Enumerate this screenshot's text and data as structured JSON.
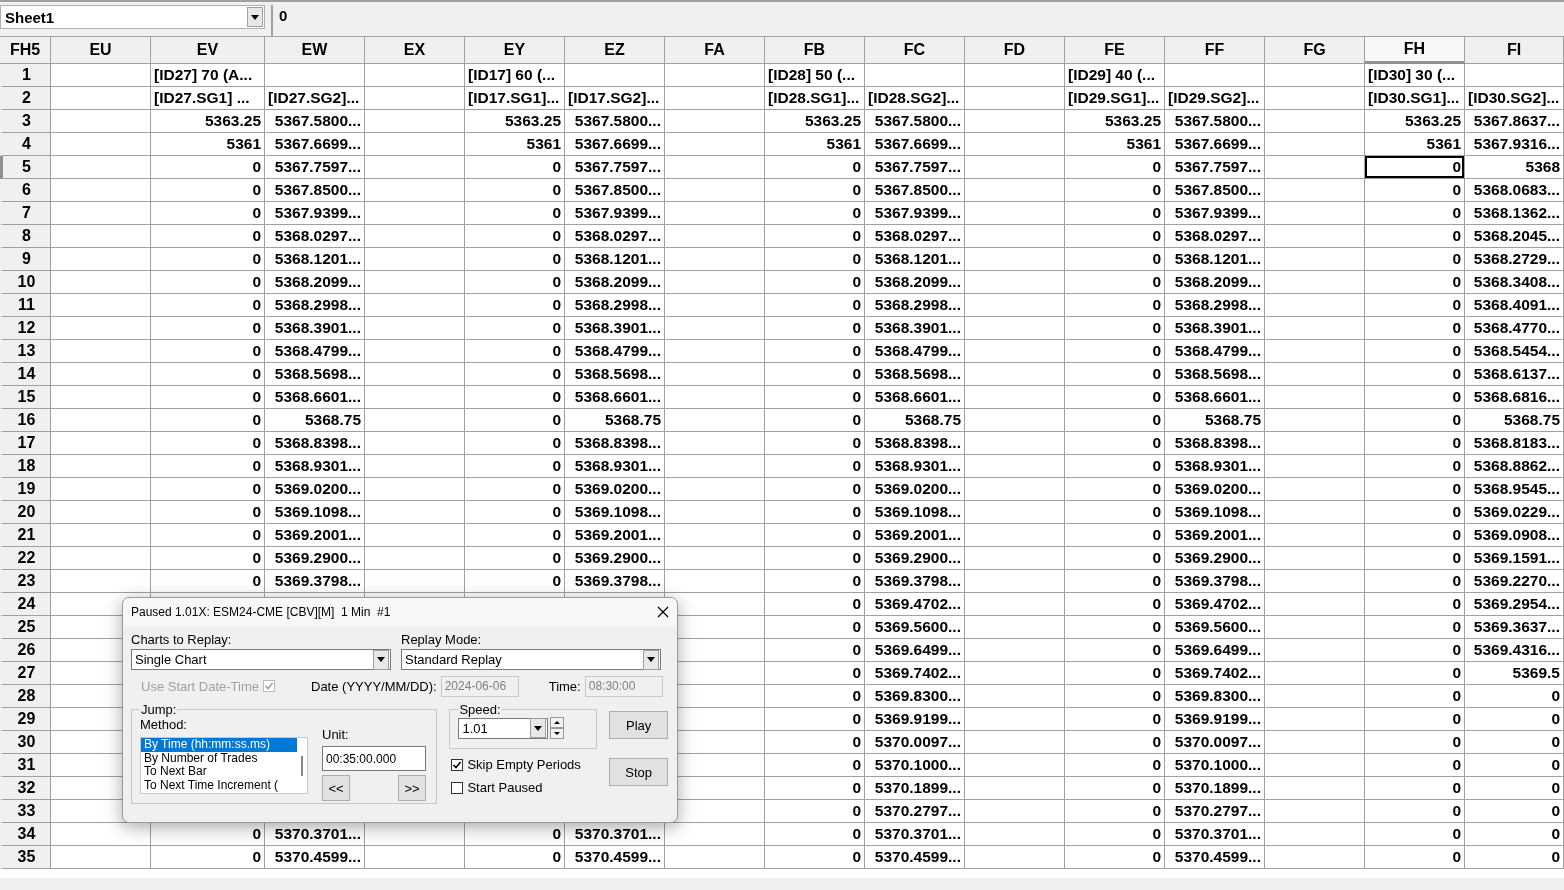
{
  "name_box": {
    "value": "Sheet1"
  },
  "formula_bar": {
    "value": "0"
  },
  "sheet": {
    "corner": "FH5",
    "columns": [
      {
        "label": "EU",
        "selected": false
      },
      {
        "label": "EV",
        "selected": false
      },
      {
        "label": "EW",
        "selected": false
      },
      {
        "label": "EX",
        "selected": false
      },
      {
        "label": "EY",
        "selected": false
      },
      {
        "label": "EZ",
        "selected": false
      },
      {
        "label": "FA",
        "selected": false
      },
      {
        "label": "FB",
        "selected": false
      },
      {
        "label": "FC",
        "selected": false
      },
      {
        "label": "FD",
        "selected": false
      },
      {
        "label": "FE",
        "selected": false
      },
      {
        "label": "FF",
        "selected": false
      },
      {
        "label": "FG",
        "selected": false
      },
      {
        "label": "FH",
        "selected": true
      },
      {
        "label": "FI",
        "selected": false
      }
    ],
    "rows": [
      {
        "label": "1",
        "selected": false,
        "kind": "text",
        "cells": [
          null,
          "[ID27] 70 (A...",
          null,
          null,
          "[ID17] 60 (...",
          null,
          null,
          "[ID28] 50 (...",
          null,
          null,
          "[ID29] 40 (...",
          null,
          null,
          "[ID30] 30 (...",
          null
        ]
      },
      {
        "label": "2",
        "selected": false,
        "kind": "text",
        "cells": [
          null,
          "[ID27.SG1] ...",
          "[ID27.SG2]...",
          null,
          "[ID17.SG1]...",
          "[ID17.SG2]...",
          null,
          "[ID28.SG1]...",
          "[ID28.SG2]...",
          null,
          "[ID29.SG1]...",
          "[ID29.SG2]...",
          null,
          "[ID30.SG1]...",
          "[ID30.SG2]..."
        ]
      },
      {
        "label": "3",
        "selected": false,
        "kind": "number",
        "cells": [
          null,
          "5363.25",
          "5367.5800...",
          null,
          "5363.25",
          "5367.5800...",
          null,
          "5363.25",
          "5367.5800...",
          null,
          "5363.25",
          "5367.5800...",
          null,
          "5363.25",
          "5367.8637..."
        ]
      },
      {
        "label": "4",
        "selected": false,
        "kind": "number",
        "cells": [
          null,
          "5361",
          "5367.6699...",
          null,
          "5361",
          "5367.6699...",
          null,
          "5361",
          "5367.6699...",
          null,
          "5361",
          "5367.6699...",
          null,
          "5361",
          "5367.9316..."
        ]
      },
      {
        "label": "5",
        "selected": true,
        "kind": "number",
        "cells": [
          null,
          "0",
          "5367.7597...",
          null,
          "0",
          "5367.7597...",
          null,
          "0",
          "5367.7597...",
          null,
          "0",
          "5367.7597...",
          null,
          "0",
          "5368"
        ]
      },
      {
        "label": "6",
        "selected": false,
        "kind": "number",
        "cells": [
          null,
          "0",
          "5367.8500...",
          null,
          "0",
          "5367.8500...",
          null,
          "0",
          "5367.8500...",
          null,
          "0",
          "5367.8500...",
          null,
          "0",
          "5368.0683..."
        ]
      },
      {
        "label": "7",
        "selected": false,
        "kind": "number",
        "cells": [
          null,
          "0",
          "5367.9399...",
          null,
          "0",
          "5367.9399...",
          null,
          "0",
          "5367.9399...",
          null,
          "0",
          "5367.9399...",
          null,
          "0",
          "5368.1362..."
        ]
      },
      {
        "label": "8",
        "selected": false,
        "kind": "number",
        "cells": [
          null,
          "0",
          "5368.0297...",
          null,
          "0",
          "5368.0297...",
          null,
          "0",
          "5368.0297...",
          null,
          "0",
          "5368.0297...",
          null,
          "0",
          "5368.2045..."
        ]
      },
      {
        "label": "9",
        "selected": false,
        "kind": "number",
        "cells": [
          null,
          "0",
          "5368.1201...",
          null,
          "0",
          "5368.1201...",
          null,
          "0",
          "5368.1201...",
          null,
          "0",
          "5368.1201...",
          null,
          "0",
          "5368.2729..."
        ]
      },
      {
        "label": "10",
        "selected": false,
        "kind": "number",
        "cells": [
          null,
          "0",
          "5368.2099...",
          null,
          "0",
          "5368.2099...",
          null,
          "0",
          "5368.2099...",
          null,
          "0",
          "5368.2099...",
          null,
          "0",
          "5368.3408..."
        ]
      },
      {
        "label": "11",
        "selected": false,
        "kind": "number",
        "cells": [
          null,
          "0",
          "5368.2998...",
          null,
          "0",
          "5368.2998...",
          null,
          "0",
          "5368.2998...",
          null,
          "0",
          "5368.2998...",
          null,
          "0",
          "5368.4091..."
        ]
      },
      {
        "label": "12",
        "selected": false,
        "kind": "number",
        "cells": [
          null,
          "0",
          "5368.3901...",
          null,
          "0",
          "5368.3901...",
          null,
          "0",
          "5368.3901...",
          null,
          "0",
          "5368.3901...",
          null,
          "0",
          "5368.4770..."
        ]
      },
      {
        "label": "13",
        "selected": false,
        "kind": "number",
        "cells": [
          null,
          "0",
          "5368.4799...",
          null,
          "0",
          "5368.4799...",
          null,
          "0",
          "5368.4799...",
          null,
          "0",
          "5368.4799...",
          null,
          "0",
          "5368.5454..."
        ]
      },
      {
        "label": "14",
        "selected": false,
        "kind": "number",
        "cells": [
          null,
          "0",
          "5368.5698...",
          null,
          "0",
          "5368.5698...",
          null,
          "0",
          "5368.5698...",
          null,
          "0",
          "5368.5698...",
          null,
          "0",
          "5368.6137..."
        ]
      },
      {
        "label": "15",
        "selected": false,
        "kind": "number",
        "cells": [
          null,
          "0",
          "5368.6601...",
          null,
          "0",
          "5368.6601...",
          null,
          "0",
          "5368.6601...",
          null,
          "0",
          "5368.6601...",
          null,
          "0",
          "5368.6816..."
        ]
      },
      {
        "label": "16",
        "selected": false,
        "kind": "number",
        "cells": [
          null,
          "0",
          "5368.75",
          null,
          "0",
          "5368.75",
          null,
          "0",
          "5368.75",
          null,
          "0",
          "5368.75",
          null,
          "0",
          "5368.75"
        ]
      },
      {
        "label": "17",
        "selected": false,
        "kind": "number",
        "cells": [
          null,
          "0",
          "5368.8398...",
          null,
          "0",
          "5368.8398...",
          null,
          "0",
          "5368.8398...",
          null,
          "0",
          "5368.8398...",
          null,
          "0",
          "5368.8183..."
        ]
      },
      {
        "label": "18",
        "selected": false,
        "kind": "number",
        "cells": [
          null,
          "0",
          "5368.9301...",
          null,
          "0",
          "5368.9301...",
          null,
          "0",
          "5368.9301...",
          null,
          "0",
          "5368.9301...",
          null,
          "0",
          "5368.8862..."
        ]
      },
      {
        "label": "19",
        "selected": false,
        "kind": "number",
        "cells": [
          null,
          "0",
          "5369.0200...",
          null,
          "0",
          "5369.0200...",
          null,
          "0",
          "5369.0200...",
          null,
          "0",
          "5369.0200...",
          null,
          "0",
          "5368.9545..."
        ]
      },
      {
        "label": "20",
        "selected": false,
        "kind": "number",
        "cells": [
          null,
          "0",
          "5369.1098...",
          null,
          "0",
          "5369.1098...",
          null,
          "0",
          "5369.1098...",
          null,
          "0",
          "5369.1098...",
          null,
          "0",
          "5369.0229..."
        ]
      },
      {
        "label": "21",
        "selected": false,
        "kind": "number",
        "cells": [
          null,
          "0",
          "5369.2001...",
          null,
          "0",
          "5369.2001...",
          null,
          "0",
          "5369.2001...",
          null,
          "0",
          "5369.2001...",
          null,
          "0",
          "5369.0908..."
        ]
      },
      {
        "label": "22",
        "selected": false,
        "kind": "number",
        "cells": [
          null,
          "0",
          "5369.2900...",
          null,
          "0",
          "5369.2900...",
          null,
          "0",
          "5369.2900...",
          null,
          "0",
          "5369.2900...",
          null,
          "0",
          "5369.1591..."
        ]
      },
      {
        "label": "23",
        "selected": false,
        "kind": "number",
        "cells": [
          null,
          "0",
          "5369.3798...",
          null,
          "0",
          "5369.3798...",
          null,
          "0",
          "5369.3798...",
          null,
          "0",
          "5369.3798...",
          null,
          "0",
          "5369.2270..."
        ]
      },
      {
        "label": "24",
        "selected": false,
        "kind": "number",
        "cells": [
          null,
          null,
          null,
          null,
          null,
          null,
          null,
          "0",
          "5369.4702...",
          null,
          "0",
          "5369.4702...",
          null,
          "0",
          "5369.2954..."
        ]
      },
      {
        "label": "25",
        "selected": false,
        "kind": "number",
        "cells": [
          null,
          null,
          null,
          null,
          null,
          null,
          null,
          "0",
          "5369.5600...",
          null,
          "0",
          "5369.5600...",
          null,
          "0",
          "5369.3637..."
        ]
      },
      {
        "label": "26",
        "selected": false,
        "kind": "number",
        "cells": [
          null,
          null,
          null,
          null,
          null,
          null,
          null,
          "0",
          "5369.6499...",
          null,
          "0",
          "5369.6499...",
          null,
          "0",
          "5369.4316..."
        ]
      },
      {
        "label": "27",
        "selected": false,
        "kind": "number",
        "cells": [
          null,
          null,
          null,
          null,
          null,
          null,
          null,
          "0",
          "5369.7402...",
          null,
          "0",
          "5369.7402...",
          null,
          "0",
          "5369.5"
        ]
      },
      {
        "label": "28",
        "selected": false,
        "kind": "number",
        "cells": [
          null,
          null,
          null,
          null,
          null,
          null,
          null,
          "0",
          "5369.8300...",
          null,
          "0",
          "5369.8300...",
          null,
          "0",
          "0"
        ]
      },
      {
        "label": "29",
        "selected": false,
        "kind": "number",
        "cells": [
          null,
          null,
          null,
          null,
          null,
          null,
          null,
          "0",
          "5369.9199...",
          null,
          "0",
          "5369.9199...",
          null,
          "0",
          "0"
        ]
      },
      {
        "label": "30",
        "selected": false,
        "kind": "number",
        "cells": [
          null,
          null,
          null,
          null,
          null,
          null,
          null,
          "0",
          "5370.0097...",
          null,
          "0",
          "5370.0097...",
          null,
          "0",
          "0"
        ]
      },
      {
        "label": "31",
        "selected": false,
        "kind": "number",
        "cells": [
          null,
          null,
          null,
          null,
          null,
          null,
          null,
          "0",
          "5370.1000...",
          null,
          "0",
          "5370.1000...",
          null,
          "0",
          "0"
        ]
      },
      {
        "label": "32",
        "selected": false,
        "kind": "number",
        "cells": [
          null,
          null,
          null,
          null,
          null,
          null,
          null,
          "0",
          "5370.1899...",
          null,
          "0",
          "5370.1899...",
          null,
          "0",
          "0"
        ]
      },
      {
        "label": "33",
        "selected": false,
        "kind": "number",
        "cells": [
          null,
          null,
          null,
          null,
          null,
          null,
          null,
          "0",
          "5370.2797...",
          null,
          "0",
          "5370.2797...",
          null,
          "0",
          "0"
        ]
      },
      {
        "label": "34",
        "selected": false,
        "kind": "number",
        "cells": [
          null,
          "0",
          "5370.3701...",
          null,
          "0",
          "5370.3701...",
          null,
          "0",
          "5370.3701...",
          null,
          "0",
          "5370.3701...",
          null,
          "0",
          "0"
        ]
      },
      {
        "label": "35",
        "selected": false,
        "kind": "number",
        "cells": [
          null,
          "0",
          "5370.4599...",
          null,
          "0",
          "5370.4599...",
          null,
          "0",
          "5370.4599...",
          null,
          "0",
          "5370.4599...",
          null,
          "0",
          "0"
        ]
      }
    ]
  },
  "replay_dialog": {
    "title": "Paused 1.01X: ESM24-CME [CBV][M]  1 Min  #1",
    "charts_to_replay": {
      "label": "Charts to Replay:",
      "value": "Single Chart"
    },
    "replay_mode": {
      "label": "Replay Mode:",
      "value": "Standard Replay"
    },
    "use_start_date_time": {
      "label": "Use Start Date-Time",
      "checked": true,
      "disabled": true
    },
    "date": {
      "label": "Date (YYYY/MM/DD):",
      "value": "2024-06-06",
      "disabled": true
    },
    "time": {
      "label": "Time:",
      "value": "08:30:00",
      "disabled": true
    },
    "jump": {
      "title": "Jump:",
      "method_label": "Method:",
      "methods": [
        {
          "label": "By Time (hh:mm:ss.ms)",
          "selected": true
        },
        {
          "label": "By Number of Trades",
          "selected": false
        },
        {
          "label": "To Next Bar",
          "selected": false
        },
        {
          "label": "To Next Time Increment (",
          "selected": false
        }
      ],
      "unit_label": "Unit:",
      "unit_value": "00:35:00.000",
      "back_button": "<<",
      "forward_button": ">>"
    },
    "speed": {
      "title": "Speed:",
      "value": "1.01"
    },
    "options": [
      {
        "label": "Skip Empty Periods",
        "checked": true
      },
      {
        "label": "Start Paused",
        "checked": false
      }
    ],
    "buttons": [
      "Play",
      "Stop"
    ]
  }
}
